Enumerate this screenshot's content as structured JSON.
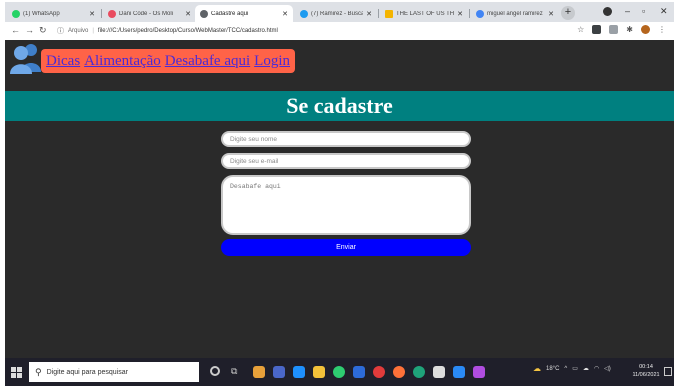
{
  "browser": {
    "tabs": [
      {
        "title": "(1) WhatsApp",
        "color": "#25d366"
      },
      {
        "title": "Dani Code - Os Moli",
        "color": "#e94b5f"
      },
      {
        "title": "Cadastre aqui",
        "color": "#5f6368"
      },
      {
        "title": "(7) Ramirez - Busca d...",
        "color": "#1d9bf0"
      },
      {
        "title": "THE LAST OF US THE",
        "color": "#f4b400"
      },
      {
        "title": "miguel angel ramirez",
        "color": "#4285f4"
      }
    ],
    "address": {
      "scheme": "Arquivo",
      "url": "file:///C:/Users/pedro/Desktop/Curso/WebMaster/TCC/cadastro.html"
    }
  },
  "page": {
    "nav": [
      "Dicas",
      "Alimentação",
      "Desabafe aqui",
      "Login"
    ],
    "title": "Se cadastre",
    "form": {
      "name_placeholder": "Digite seu nome",
      "email_placeholder": "Digite seu e-mail",
      "message_placeholder": "Desabafe aqui",
      "submit_label": "Enviar"
    },
    "colors": {
      "nav_bg": "#ff6347",
      "title_bar": "#008080",
      "button": "#0000ff",
      "background": "#2a2a2a"
    }
  },
  "taskbar": {
    "search_placeholder": "Digite aqui para pesquisar",
    "weather": "18°C",
    "time": "00:14",
    "date": "11/06/2021"
  }
}
